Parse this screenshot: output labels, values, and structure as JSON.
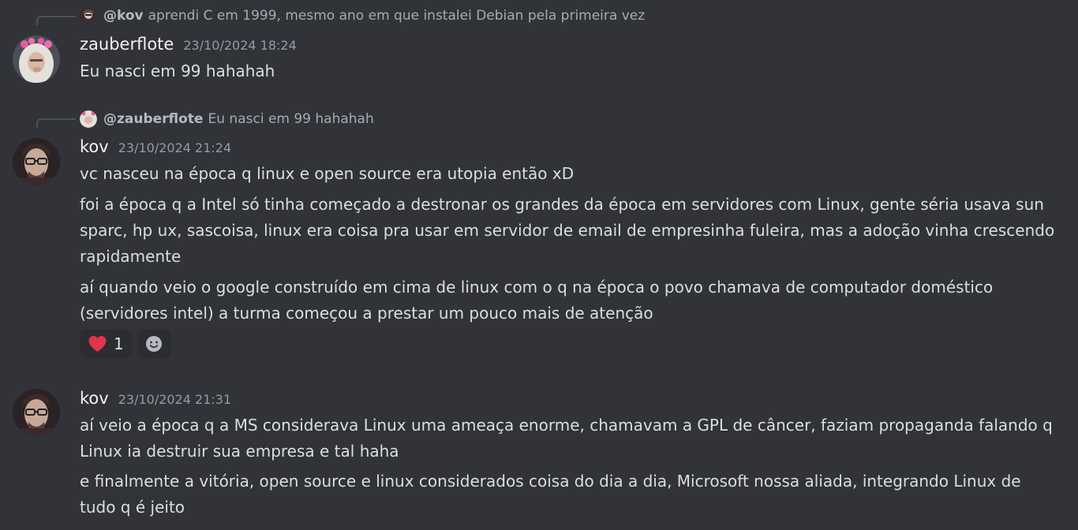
{
  "messages": [
    {
      "reply": {
        "mention": "@kov",
        "text": "aprendi C em 1999, mesmo ano em que instalei Debian pela primeira vez"
      },
      "author": "zauberflote",
      "timestamp": "23/10/2024 18:24",
      "avatar_icon": "user-avatar-pink-hair",
      "lines": [
        "Eu nasci em 99 hahahah"
      ]
    },
    {
      "reply": {
        "mention": "@zauberflote",
        "text": "Eu nasci em 99 hahahah"
      },
      "author": "kov",
      "timestamp": "23/10/2024 21:24",
      "avatar_icon": "user-avatar-glasses",
      "lines": [
        "vc nasceu na época q linux e open source era utopia então xD",
        "foi a época q a Intel só tinha começado a destronar os grandes da época em servidores com Linux, gente séria usava sun sparc, hp ux, sascoisa, linux era coisa pra usar em servidor de email de empresinha fuleira, mas a adoção vinha crescendo rapidamente",
        "aí quando veio o google construído em cima de linux com o q na época o povo chamava de computador doméstico (servidores intel) a turma começou a prestar um pouco mais de atenção"
      ],
      "reactions": [
        {
          "emoji": "heart-icon",
          "count": "1",
          "color": "#e3344e"
        }
      ]
    },
    {
      "author": "kov",
      "timestamp": "23/10/2024 21:31",
      "avatar_icon": "user-avatar-glasses",
      "lines": [
        "aí veio a época q a MS considerava Linux uma ameaça enorme, chamavam a GPL de câncer, faziam propaganda falando q Linux ia destruir sua empresa e tal haha",
        "e finalmente a vitória, open source e linux considerados coisa do dia a dia, Microsoft nossa aliada, integrando Linux de tudo q é jeito"
      ]
    }
  ],
  "colors": {
    "background": "#313338",
    "text": "#dbdee1",
    "username": "#f2f3f5",
    "timestamp": "#949ba4",
    "reaction_bg": "#2b2d31"
  }
}
